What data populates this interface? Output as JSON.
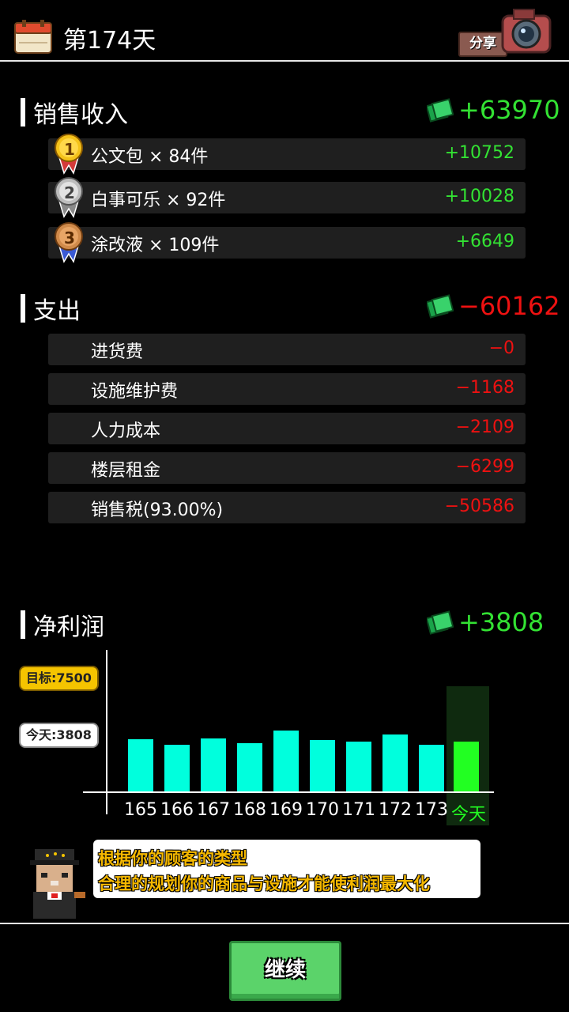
{
  "header": {
    "title": "第174天",
    "share_label": "分享"
  },
  "sales": {
    "title": "销售收入",
    "total": "+63970",
    "items": [
      {
        "rank": "1",
        "label": "公文包 × 84件",
        "value": "+10752"
      },
      {
        "rank": "2",
        "label": "白事可乐 × 92件",
        "value": "+10028"
      },
      {
        "rank": "3",
        "label": "涂改液 × 109件",
        "value": "+6649"
      }
    ]
  },
  "expense": {
    "title": "支出",
    "total": "−60162",
    "items": [
      {
        "label": "进货费",
        "value": "−0"
      },
      {
        "label": "设施维护费",
        "value": "−1168"
      },
      {
        "label": "人力成本",
        "value": "−2109"
      },
      {
        "label": "楼层租金",
        "value": "−6299"
      },
      {
        "label": "销售税(93.00%)",
        "value": "−50586"
      }
    ]
  },
  "profit": {
    "title": "净利润",
    "total": "+3808",
    "target_label": "目标:7500",
    "today_label": "今天:3808"
  },
  "chart_data": {
    "type": "bar",
    "categories": [
      "165",
      "166",
      "167",
      "168",
      "169",
      "170",
      "171",
      "172",
      "173",
      "今天"
    ],
    "values": [
      3450,
      3100,
      3500,
      3200,
      4050,
      3400,
      3300,
      3750,
      3100,
      3300
    ],
    "target": 7500,
    "ylim": [
      0,
      7500
    ],
    "colors": {
      "past": "#00ffdd",
      "today": "#22ff22"
    }
  },
  "tip": {
    "line1": "根据你的顾客的类型",
    "line2": "合理的规划你的商品与设施才能使利润最大化"
  },
  "footer": {
    "continue_label": "继续"
  },
  "colors": {
    "positive": "#33e233",
    "negative": "#ee1111",
    "accent": "#f5b800"
  }
}
